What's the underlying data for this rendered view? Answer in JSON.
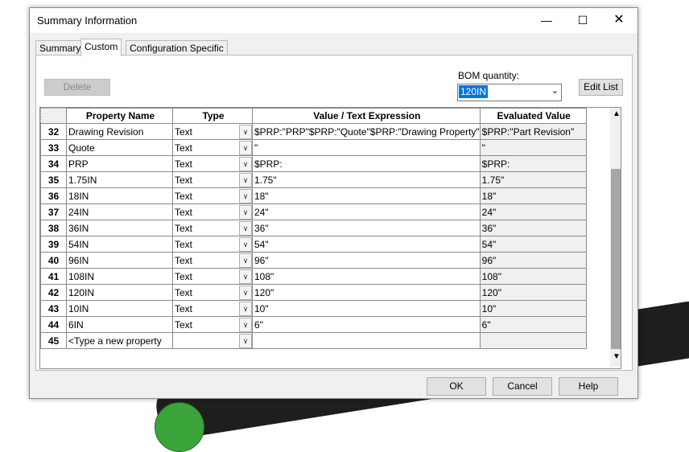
{
  "window": {
    "title": "Summary Information",
    "minimize_glyph": "—",
    "maximize_glyph": "☐",
    "close_glyph": "✕"
  },
  "tabs": [
    {
      "label": "Summary"
    },
    {
      "label": "Custom"
    },
    {
      "label": "Configuration Specific"
    }
  ],
  "active_tab": "Custom",
  "toolbar": {
    "delete_label": "Delete",
    "bom_label": "BOM quantity:",
    "bom_value": "120IN",
    "edit_list_label": "Edit List"
  },
  "table": {
    "headers": [
      "Property Name",
      "Type",
      "Value / Text Expression",
      "Evaluated Value"
    ],
    "rows": [
      {
        "num": "32",
        "name": "Drawing Revision",
        "type": "Text",
        "value": "$PRP:\"PRP\"$PRP:\"Quote\"$PRP:\"Drawing Property\"",
        "evaluated": "$PRP:\"Part Revision\""
      },
      {
        "num": "33",
        "name": "Quote",
        "type": "Text",
        "value": "\"",
        "evaluated": "\""
      },
      {
        "num": "34",
        "name": "PRP",
        "type": "Text",
        "value": "$PRP:",
        "evaluated": "$PRP:"
      },
      {
        "num": "35",
        "name": "1.75IN",
        "type": "Text",
        "value": "1.75\"",
        "evaluated": "1.75\""
      },
      {
        "num": "36",
        "name": "18IN",
        "type": "Text",
        "value": "18\"",
        "evaluated": "18\""
      },
      {
        "num": "37",
        "name": "24IN",
        "type": "Text",
        "value": "24\"",
        "evaluated": "24\""
      },
      {
        "num": "38",
        "name": "36IN",
        "type": "Text",
        "value": "36\"",
        "evaluated": "36\""
      },
      {
        "num": "39",
        "name": "54IN",
        "type": "Text",
        "value": "54\"",
        "evaluated": "54\""
      },
      {
        "num": "40",
        "name": "96IN",
        "type": "Text",
        "value": "96\"",
        "evaluated": "96\""
      },
      {
        "num": "41",
        "name": "108IN",
        "type": "Text",
        "value": "108\"",
        "evaluated": "108\""
      },
      {
        "num": "42",
        "name": "120IN",
        "type": "Text",
        "value": "120\"",
        "evaluated": "120\""
      },
      {
        "num": "43",
        "name": "10IN",
        "type": "Text",
        "value": "10\"",
        "evaluated": "10\""
      },
      {
        "num": "44",
        "name": "6IN",
        "type": "Text",
        "value": "6\"",
        "evaluated": "6\""
      },
      {
        "num": "45",
        "name": "<Type a new property",
        "type": "",
        "value": "",
        "evaluated": ""
      }
    ]
  },
  "footer": {
    "ok_label": "OK",
    "cancel_label": "Cancel",
    "help_label": "Help"
  },
  "colors": {
    "selection": "#0078d7",
    "dialog_bg": "#f0f0f0",
    "evaluated_bg": "#f0f0f0"
  }
}
